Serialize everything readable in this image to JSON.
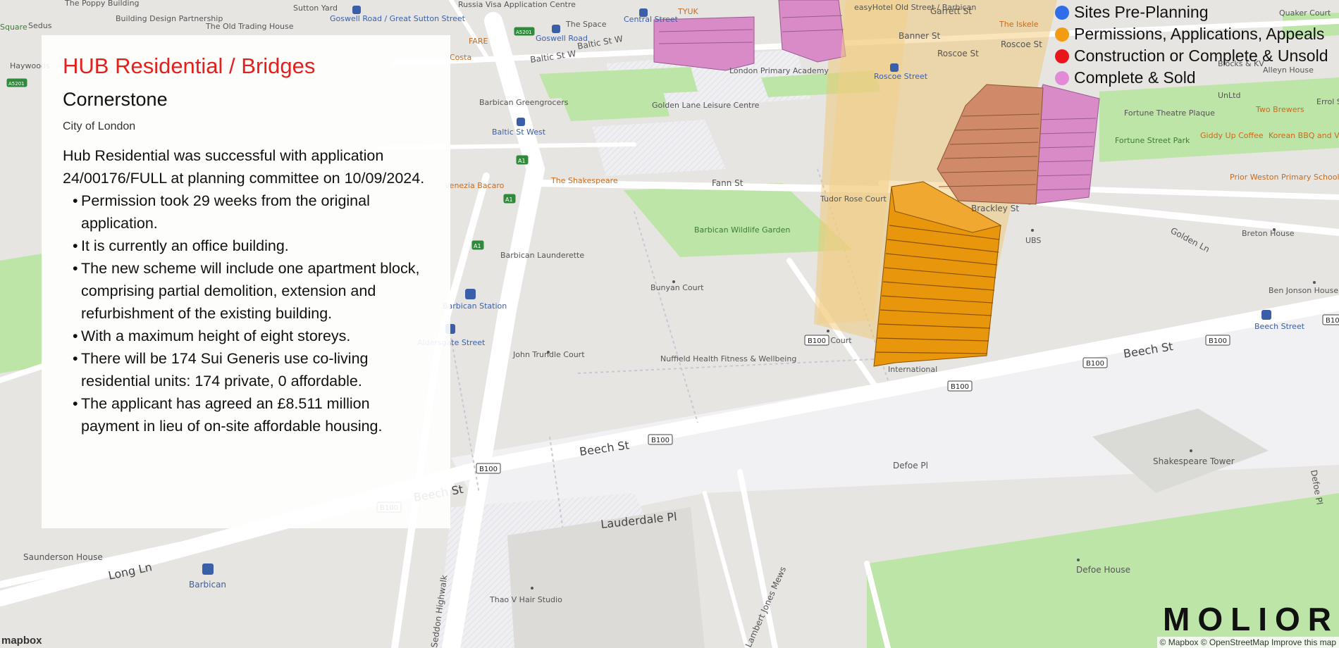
{
  "panel": {
    "title": "HUB Residential / Bridges",
    "subtitle": "Cornerstone",
    "area": "City of London",
    "intro": "Hub Residential was successful with application 24/00176/FULL at planning committee on 10/09/2024.",
    "bullets": [
      "Permission took 29 weeks from the original application.",
      "It is currently an office building.",
      "The new scheme will include one apartment block, comprising partial demolition, extension and refurbishment of the existing building.",
      "With a maximum height of eight storeys.",
      "There will be 174 Sui Generis use co-living residential units: 174 private, 0 affordable.",
      "The applicant has agreed an £8.511 million payment in lieu of on-site affordable housing."
    ]
  },
  "legend": [
    {
      "label": "Sites Pre-Planning",
      "color": "#2f6ee8"
    },
    {
      "label": "Permissions, Applications, Appeals",
      "color": "#f39c12"
    },
    {
      "label": "Construction or Complete & Unsold",
      "color": "#e8161b"
    },
    {
      "label": "Complete & Sold",
      "color": "#e38ad6"
    }
  ],
  "logo": "MOLIOR",
  "mapbox_logo": "mapbox",
  "attribution": "© Mapbox © OpenStreetMap Improve this map",
  "map_labels": {
    "beech_st": "Beech St",
    "beech_st_2": "Beech St",
    "beech_st_3": "Beech St",
    "lauderdale_pl": "Lauderdale Pl",
    "long_ln": "Long Ln",
    "golden_ln": "Golden Ln",
    "fann_st": "Fann St",
    "baltic_st_w": "Baltic St W",
    "baltic_st_w2": "Baltic St W",
    "banner_st": "Banner St",
    "roscoe_st": "Roscoe St",
    "roscoe_st2": "Roscoe St",
    "garrett_st": "Garrett St",
    "defoe_pl": "Defoe Pl",
    "defoe_pl_2": "Defoe Pl",
    "seddon_highwalk": "Seddon Highwalk",
    "lambert_jones_mews": "Lambert Jones Mews",
    "brackley_st": "Brackley St",
    "defoe_house": "Defoe House",
    "shakespeare_tower": "Shakespeare Tower",
    "saunderson_house": "Saunderson House",
    "barbican": "Barbican",
    "barbican_station": "Barbican Station",
    "aldersgate_street": "Aldersgate Street",
    "beech_street": "Beech Street",
    "baltic_st_west": "Baltic St West",
    "barbican_wildlife_garden": "Barbican Wildlife Garden",
    "barbican_launderette": "Barbican Launderette",
    "bunyan_court": "Bunyan Court",
    "john_trundle_court": "John Trundle Court",
    "nuffield": "Nuffield Health Fitness & Wellbeing",
    "bryer_court": "Bryer Court",
    "tudor_rose_court": "Tudor Rose Court",
    "international": "International",
    "ben_jonson_house": "Ben Jonson House",
    "breton_house": "Breton House",
    "ubs": "UBS",
    "fortune_street_park": "Fortune Street Park",
    "fortune_theatre_plaque": "Fortune Theatre Plaque",
    "prior_weston": "Prior Weston Primary School and Children's Centre",
    "giddy_up_coffee": "Giddy Up Coffee",
    "korean_bbq": "Korean BBQ and Vegan Restaurant",
    "two_brewers": "Two Brewers",
    "errol_st": "Errol St",
    "quaker_court": "Quaker Court",
    "alleyn_house": "Alleyn House",
    "the_shakespeare": "The Shakespeare",
    "barbican_greengrocers": "Barbican Greengrocers",
    "golden_lane_leisure": "Golden Lane Leisure Centre",
    "london_primary_academy": "London Primary Academy",
    "roscoe_street": "Roscoe Street",
    "thao_v_hair": "Thao V Hair Studio",
    "central_street": "Central Street",
    "goswell_road": "Goswell Road",
    "goswell_road_great_sutton": "Goswell Road / Great Sutton Street",
    "the_old_trading_house": "The Old Trading House",
    "building_design_partnership": "Building Design Partnership",
    "sutton_yard": "Sutton Yard",
    "the_poppy_building": "The Poppy Building",
    "the_space": "The Space",
    "russia_visa": "Russia Visa Application Centre",
    "fare": "FARE",
    "costa": "Costa",
    "venezia_bacaro": "Venezia Bacaro",
    "haywoods": "Haywoods",
    "sedus": "Sedus",
    "square": "Square",
    "tyuk": "TYUK",
    "the_iskele": "The Iskele",
    "easyhotel": "easyHotel Old Street / Barbican",
    "unltd": "UnLtd",
    "blocks_kv": "Blocks & KV",
    "shield_a1": "A1",
    "shield_a5201": "A5201",
    "shield_b100": "B100"
  }
}
